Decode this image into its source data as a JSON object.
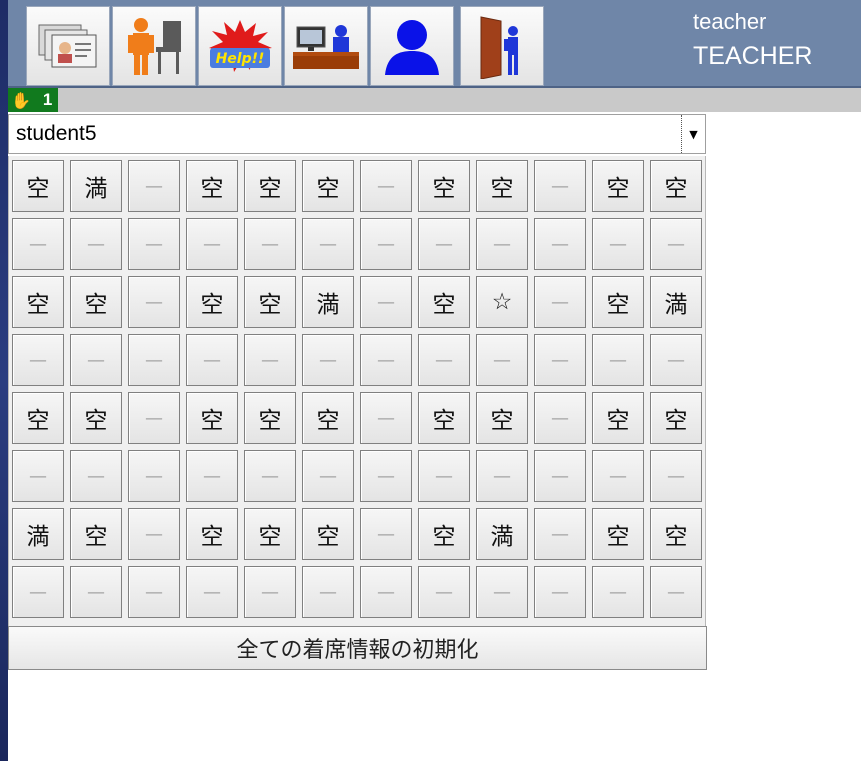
{
  "header": {
    "toolbar": [
      {
        "icon": "student-cards-icon",
        "tooltip": ""
      },
      {
        "icon": "seat-person-icon",
        "tooltip": ""
      },
      {
        "icon": "help-icon",
        "label": "Help!!"
      },
      {
        "icon": "teacher-desk-icon",
        "tooltip": ""
      },
      {
        "icon": "user-icon",
        "tooltip": ""
      },
      {
        "icon": "exit-door-icon",
        "tooltip": ""
      }
    ],
    "user": {
      "name": "teacher",
      "role": "TEACHER"
    }
  },
  "status": {
    "hand_icon": "raised-hand-icon",
    "hand_count": "1"
  },
  "student_select": {
    "value": "student5"
  },
  "seats": {
    "rows": [
      [
        "空",
        "満",
        "—",
        "空",
        "空",
        "空",
        "—",
        "空",
        "空",
        "—",
        "空",
        "空"
      ],
      [
        "—",
        "—",
        "—",
        "—",
        "—",
        "—",
        "—",
        "—",
        "—",
        "—",
        "—",
        "—"
      ],
      [
        "空",
        "空",
        "—",
        "空",
        "空",
        "満",
        "—",
        "空",
        "☆",
        "—",
        "空",
        "満"
      ],
      [
        "—",
        "—",
        "—",
        "—",
        "—",
        "—",
        "—",
        "—",
        "—",
        "—",
        "—",
        "—"
      ],
      [
        "空",
        "空",
        "—",
        "空",
        "空",
        "空",
        "—",
        "空",
        "空",
        "—",
        "空",
        "空"
      ],
      [
        "—",
        "—",
        "—",
        "—",
        "—",
        "—",
        "—",
        "—",
        "—",
        "—",
        "—",
        "—"
      ],
      [
        "満",
        "空",
        "—",
        "空",
        "空",
        "空",
        "—",
        "空",
        "満",
        "—",
        "空",
        "空"
      ],
      [
        "—",
        "—",
        "—",
        "—",
        "—",
        "—",
        "—",
        "—",
        "—",
        "—",
        "—",
        "—"
      ]
    ]
  },
  "reset_button": {
    "label": "全ての着席情報の初期化"
  },
  "colors": {
    "header_bg": "#6f86a8",
    "hand_badge": "#117a1e",
    "status_strip": "#c9c9c9"
  }
}
